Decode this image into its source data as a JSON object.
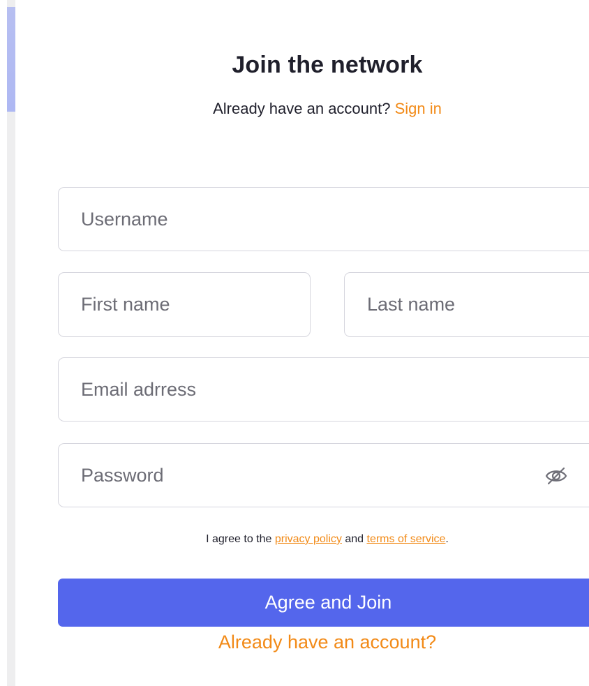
{
  "header": {
    "title": "Join the network",
    "subtitle_prefix": "Already have an account?",
    "sign_in_link": "Sign in"
  },
  "form": {
    "username_placeholder": "Username",
    "first_name_placeholder": "First name",
    "last_name_placeholder": "Last name",
    "email_placeholder": "Email adrress",
    "password_placeholder": "Password",
    "password_toggle_icon": "eye-slash-icon"
  },
  "consent": {
    "prefix": "I agree to the",
    "privacy_link": "privacy policy",
    "conjunction": "and",
    "terms_link": "terms of service",
    "suffix": "."
  },
  "actions": {
    "join_button": "Agree and Join",
    "already_link": "Already have an account?"
  },
  "colors": {
    "accent": "#f28a17",
    "primary_button": "#5466ec",
    "field_border": "#d6d6de",
    "scroll_thumb": "#aeb8f3"
  }
}
